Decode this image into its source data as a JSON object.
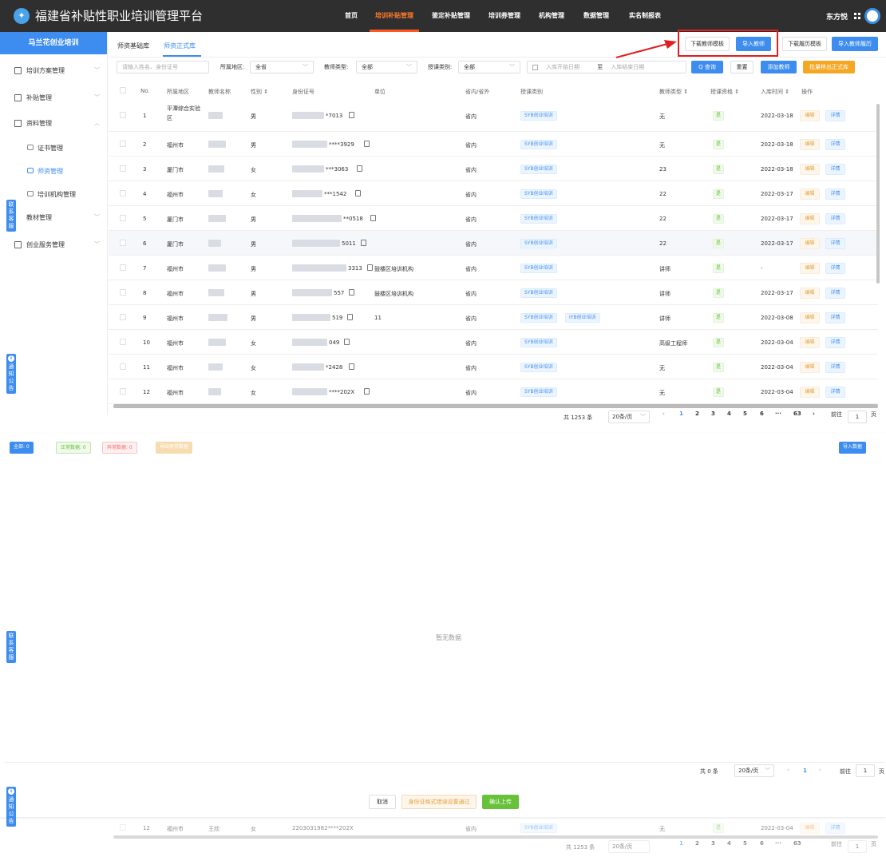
{
  "app": {
    "title": "福建省补贴性职业培训管理平台",
    "logo_icon": "platform-logo-icon"
  },
  "topnav": [
    "首页",
    "培训补贴管理",
    "鉴定补贴管理",
    "培训券管理",
    "机构管理",
    "数据管理",
    "实名制报表"
  ],
  "topnav_active_index": 1,
  "user": {
    "name": "东方悦"
  },
  "sidebar": {
    "header": "马兰花创业培训",
    "items": [
      {
        "label": "培训方案管理",
        "icon": "doc-icon"
      },
      {
        "label": "补贴管理",
        "icon": "doc-icon"
      },
      {
        "label": "资料管理",
        "icon": "home-icon"
      },
      {
        "label": "证书管理",
        "icon": "cert-icon"
      },
      {
        "label": "师资管理",
        "icon": "cert-icon"
      },
      {
        "label": "培训机构管理",
        "icon": "cert-icon"
      },
      {
        "label": "教材管理",
        "icon": "home-icon"
      },
      {
        "label": "创业服务管理",
        "icon": "home-icon"
      }
    ],
    "float_contact": "联系客服",
    "float_notice": "通知公告",
    "notice_dot": "i"
  },
  "tabs": [
    "师资基础库",
    "师资正式库"
  ],
  "toolbar": {
    "download_teacher_template": "下载教师模板",
    "import_teacher": "导入教师",
    "download_resume_template": "下载履历模板",
    "import_teacher_resume": "导入教师履历"
  },
  "filters": {
    "search_placeholder": "请输入姓名、身份证号",
    "region_label": "所属地区:",
    "region_value": "全省",
    "teacher_type_label": "教师类型:",
    "teacher_type_value": "全部",
    "course_type_label": "授课类别:",
    "course_type_value": "全部",
    "date_start_placeholder": "入库开始日期",
    "date_sep": "至",
    "date_end_placeholder": "入库结束日期",
    "query": "Q 查询",
    "reset": "重置",
    "add_teacher": "添加教师",
    "batch_remove": "批量移出正式库"
  },
  "table": {
    "headers": [
      "No.",
      "所属地区",
      "教师名称",
      "性别 ⇕",
      "身份证号",
      "单位",
      "省内/省外",
      "授课类别",
      "教师类型 ⇕",
      "授课资格 ⇕",
      "入库时间 ⇕",
      "操作"
    ],
    "rows": [
      {
        "no": "1",
        "region": "平潭综合实验区",
        "gender": "男",
        "id_tail": "*7013",
        "unit": "",
        "scope": "省内",
        "courses": [
          "SYB创业培训"
        ],
        "type": "无",
        "qual": "是",
        "date": "2022-03-18"
      },
      {
        "no": "2",
        "region": "福州市",
        "gender": "男",
        "id_tail": "****3929",
        "unit": "",
        "scope": "省内",
        "courses": [
          "SYB创业培训"
        ],
        "type": "无",
        "qual": "是",
        "date": "2022-03-18"
      },
      {
        "no": "3",
        "region": "厦门市",
        "gender": "女",
        "id_tail": "***3063",
        "unit": "",
        "scope": "省内",
        "courses": [
          "SYB创业培训"
        ],
        "type": "23",
        "qual": "是",
        "date": "2022-03-18"
      },
      {
        "no": "4",
        "region": "福州市",
        "gender": "女",
        "id_tail": "***1542",
        "unit": "",
        "scope": "省内",
        "courses": [
          "SYB创业培训"
        ],
        "type": "22",
        "qual": "是",
        "date": "2022-03-17"
      },
      {
        "no": "5",
        "region": "厦门市",
        "gender": "男",
        "id_tail": "**0518",
        "unit": "",
        "scope": "省内",
        "courses": [
          "SYB创业培训"
        ],
        "type": "22",
        "qual": "是",
        "date": "2022-03-17"
      },
      {
        "no": "6",
        "region": "厦门市",
        "gender": "男",
        "id_tail": "5011",
        "unit": "",
        "scope": "省内",
        "courses": [
          "SYB创业培训"
        ],
        "type": "22",
        "qual": "是",
        "date": "2022-03-17"
      },
      {
        "no": "7",
        "region": "福州市",
        "gender": "男",
        "id_tail": "3313",
        "unit": "鼓楼区培训机构",
        "scope": "省内",
        "courses": [
          "SYB创业培训"
        ],
        "type": "讲师",
        "qual": "是",
        "date": "-"
      },
      {
        "no": "8",
        "region": "福州市",
        "gender": "男",
        "id_tail": "557",
        "unit": "鼓楼区培训机构",
        "scope": "省内",
        "courses": [
          "SYB创业培训"
        ],
        "type": "讲师",
        "qual": "是",
        "date": "2022-03-17"
      },
      {
        "no": "9",
        "region": "福州市",
        "gender": "男",
        "id_tail": "519",
        "unit": "11",
        "scope": "省内",
        "courses": [
          "SYB创业培训",
          "IYB创业培训"
        ],
        "type": "讲师",
        "qual": "是",
        "date": "2022-03-08"
      },
      {
        "no": "10",
        "region": "福州市",
        "gender": "女",
        "id_tail": "049",
        "unit": "",
        "scope": "省内",
        "courses": [
          "SYB创业培训"
        ],
        "type": "高级工程师",
        "qual": "是",
        "date": "2022-03-04"
      },
      {
        "no": "11",
        "region": "福州市",
        "gender": "女",
        "id_tail": "*2428",
        "unit": "",
        "scope": "省内",
        "courses": [
          "SYB创业培训"
        ],
        "type": "无",
        "qual": "是",
        "date": "2022-03-04"
      },
      {
        "no": "12",
        "region": "福州市",
        "gender": "女",
        "id_tail": "****202X",
        "unit": "",
        "scope": "省内",
        "courses": [
          "SYB创业培训"
        ],
        "type": "无",
        "qual": "是",
        "date": "2022-03-04"
      }
    ],
    "edit_label": "编辑",
    "detail_label": "详情"
  },
  "pagination": {
    "total": "共 1253 条",
    "page_size": "20条/页",
    "pages": [
      "1",
      "2",
      "3",
      "4",
      "5",
      "6",
      "···",
      "63"
    ],
    "goto_label": "前往",
    "goto_value": "1",
    "page_unit": "页"
  },
  "import_dialog": {
    "all": "全部: 0",
    "normal": "正常数据: 0",
    "abnormal": "异常数据: 0",
    "export_abnormal": "导出异常数据",
    "import_data": "导入数据",
    "empty": "暂无数据",
    "total": "共 0 条",
    "page_size": "20条/页",
    "page": "1",
    "goto_label": "前往",
    "goto_value": "1",
    "page_unit": "页",
    "cancel": "取消",
    "id_check": "身份证格式错误设置通过",
    "confirm_upload": "确认上传"
  },
  "bottom_row": {
    "no": "12",
    "region": "福州市",
    "name": "王欣",
    "gender": "女",
    "id": "2203031982****202X",
    "scope": "省内",
    "course": "SYB创业培训",
    "type": "无",
    "qual": "是",
    "date": "2022-03-04",
    "edit": "编辑",
    "detail": "详情"
  },
  "colors": {
    "topbar": "#2f2f30",
    "primary": "#3d8cf0",
    "nav_active": "#ff7a29",
    "warning": "#f5a623",
    "success": "#67c23a",
    "highlight_box": "#e02020"
  }
}
